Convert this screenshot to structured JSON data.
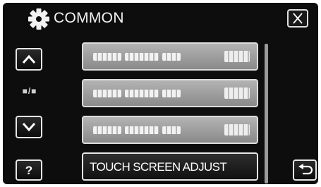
{
  "header": {
    "title": "COMMON",
    "settings_icon": "gear-icon",
    "close_icon": "close-icon"
  },
  "sidebar": {
    "scroll_up_icon": "chevron-up-icon",
    "page_indicator": "■/■",
    "scroll_down_icon": "chevron-down-icon",
    "help_label": "?"
  },
  "menu": {
    "items": [
      {
        "label": "",
        "obscured": true
      },
      {
        "label": "",
        "obscured": true
      },
      {
        "label": "",
        "obscured": true
      },
      {
        "label": "TOUCH SCREEN ADJUST",
        "obscured": false
      }
    ]
  },
  "footer": {
    "back_icon": "return-arrow-icon"
  },
  "colors": {
    "background": "#0d0d0d",
    "menu_item": "#a0a0a0",
    "menu_item_active": "#1e1e1e",
    "text": "#ffffff"
  }
}
